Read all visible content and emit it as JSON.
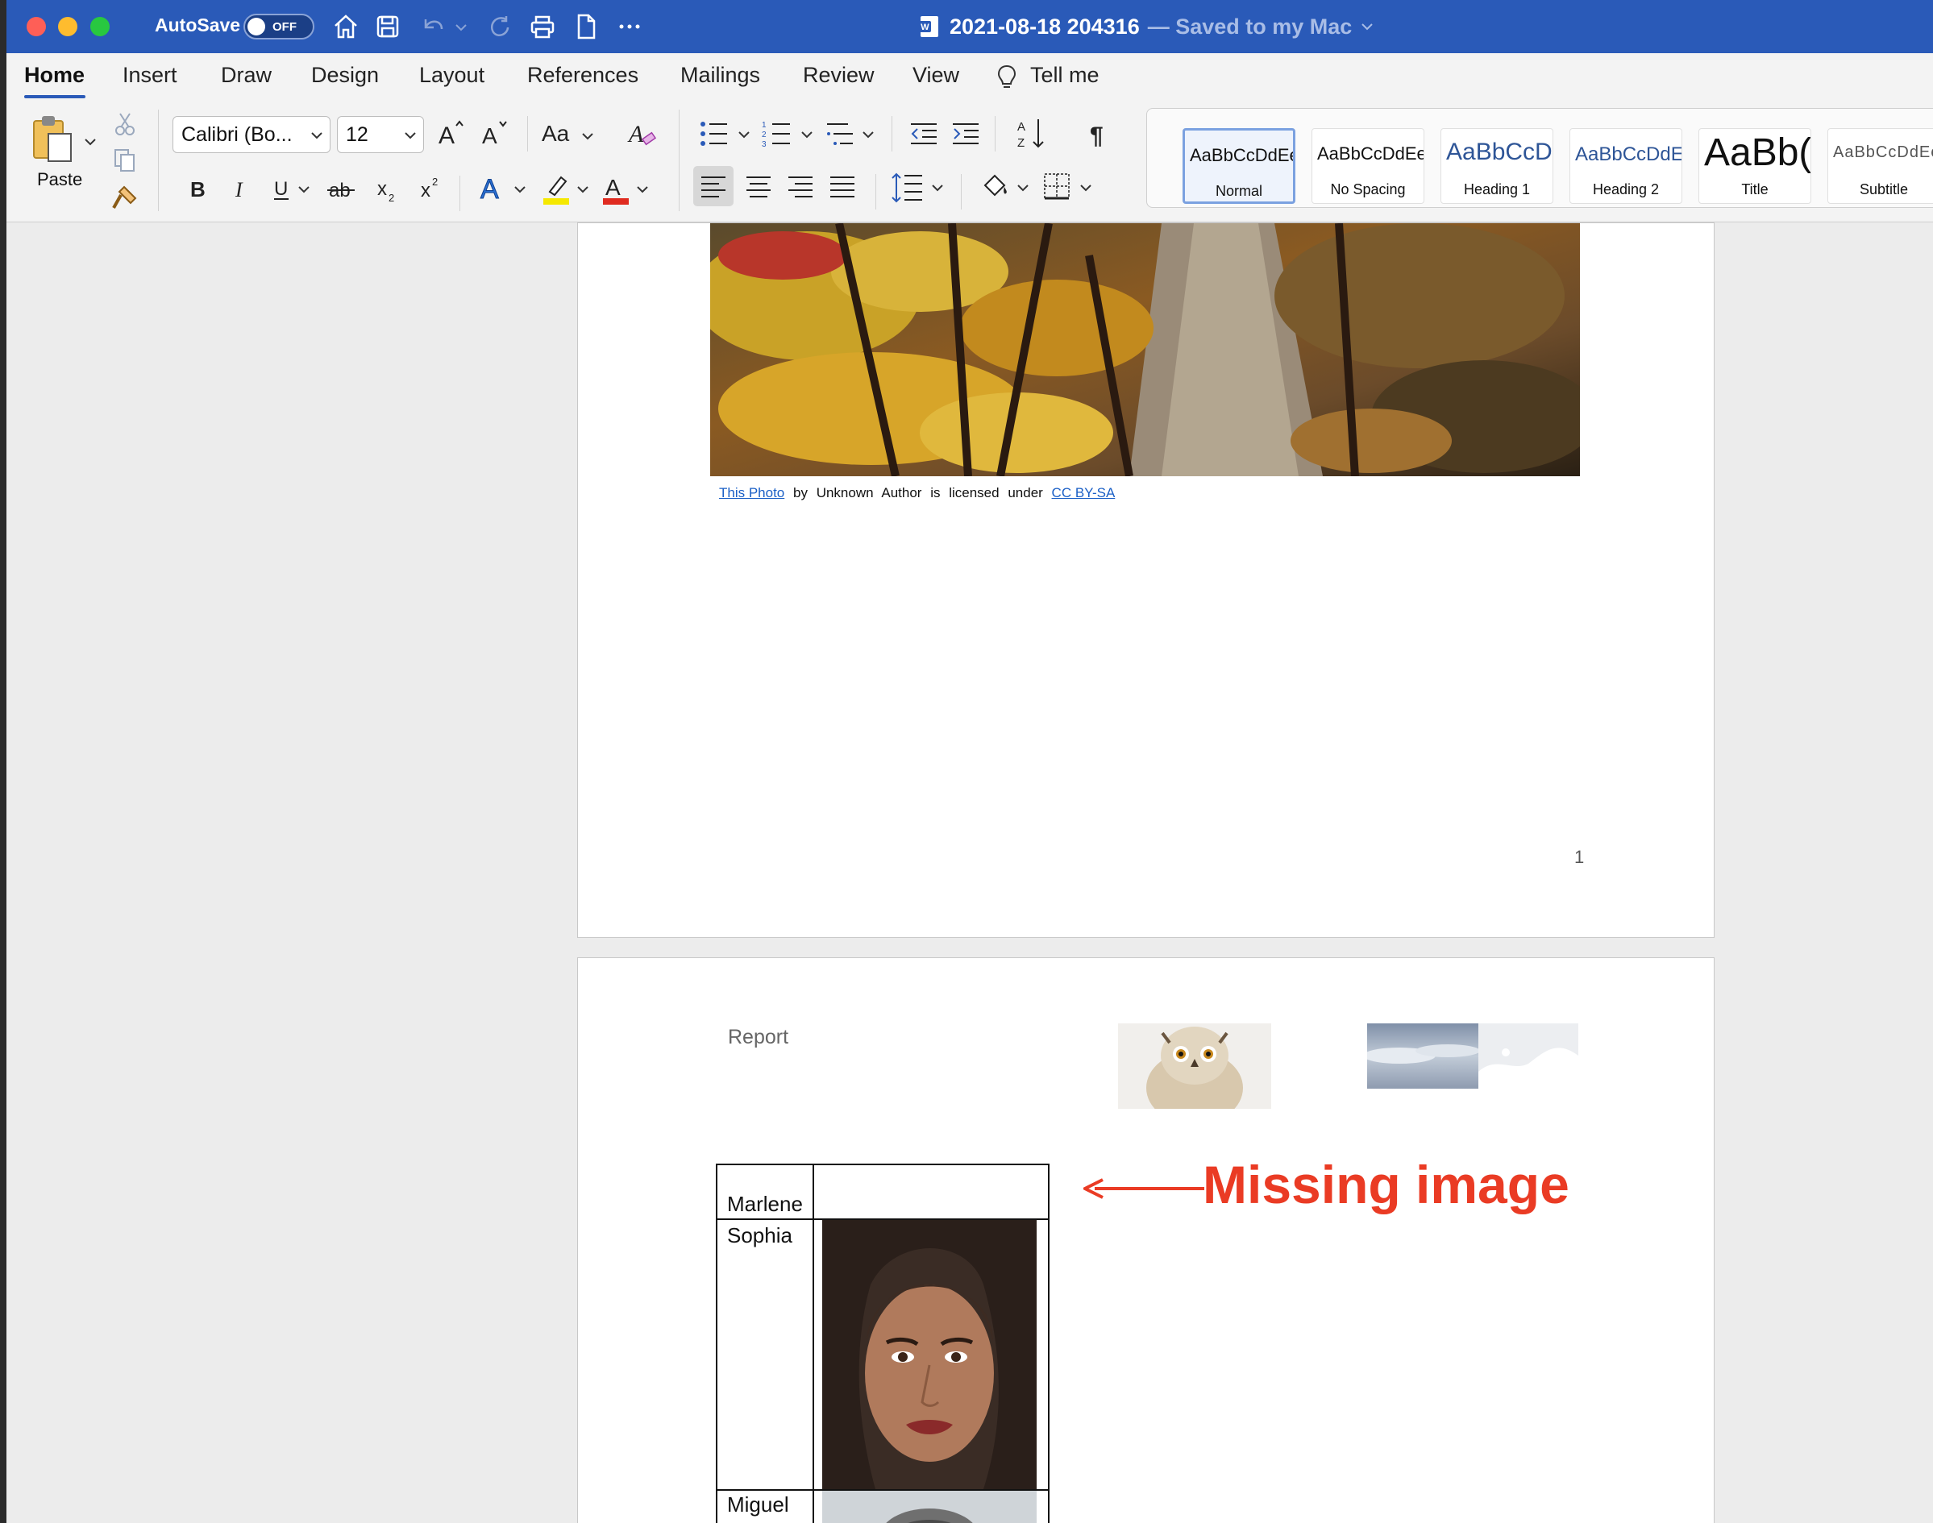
{
  "titlebar": {
    "autosave_label": "AutoSave",
    "autosave_state": "OFF",
    "doc_title": "2021-08-18 204316",
    "doc_saved": "— Saved to my Mac"
  },
  "tabs": [
    "Home",
    "Insert",
    "Draw",
    "Design",
    "Layout",
    "References",
    "Mailings",
    "Review",
    "View",
    "Tell me"
  ],
  "ribbon": {
    "paste_label": "Paste",
    "font_name": "Calibri (Bo...",
    "font_size": "12",
    "change_case": "Aa",
    "styles": [
      {
        "preview": "AaBbCcDdEe",
        "name": "Normal"
      },
      {
        "preview": "AaBbCcDdEe",
        "name": "No Spacing"
      },
      {
        "preview": "AaBbCcDc",
        "name": "Heading 1"
      },
      {
        "preview": "AaBbCcDdEe",
        "name": "Heading 2"
      },
      {
        "preview": "AaBb(",
        "name": "Title"
      },
      {
        "preview": "AaBbCcDdEe",
        "name": "Subtitle"
      }
    ],
    "colors": {
      "highlight": "#f5e800",
      "font_color": "#e02b20",
      "text_effect": "#2a6fd1"
    }
  },
  "page1": {
    "caption": {
      "link1": "This Photo",
      "middle_words": [
        "by",
        "Unknown",
        "Author",
        "is",
        "licensed",
        "under"
      ],
      "link2": "CC BY-SA"
    },
    "page_number": "1"
  },
  "page2": {
    "header_text": "Report",
    "table": [
      {
        "name": "Marlene",
        "image": ""
      },
      {
        "name": "Sophia",
        "image": "portrait"
      },
      {
        "name": "Miguel",
        "image": "portrait"
      }
    ]
  },
  "annotation": {
    "text": "Missing image",
    "color": "#ea3b24"
  }
}
